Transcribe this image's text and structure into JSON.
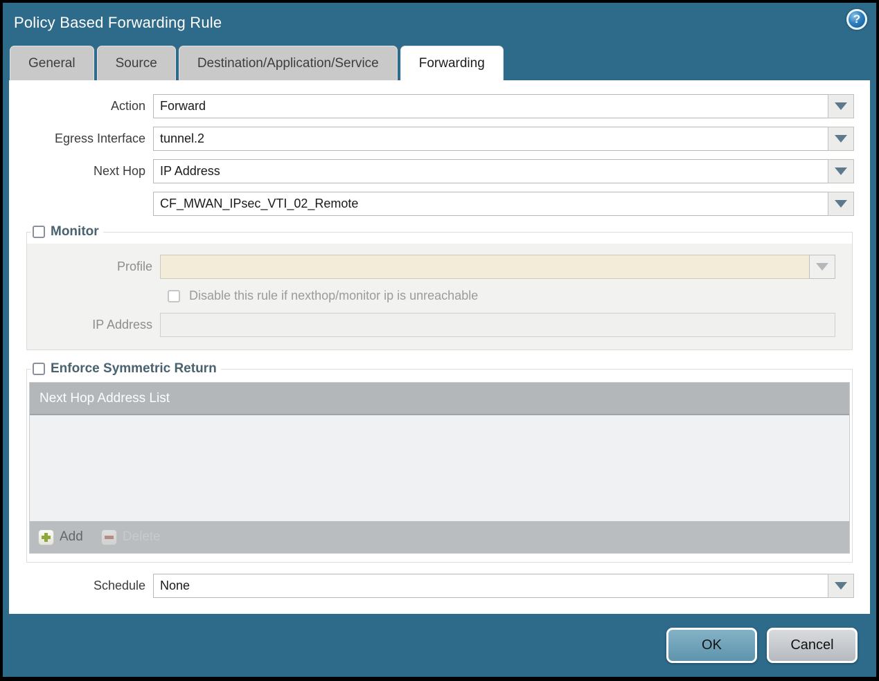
{
  "dialog": {
    "title": "Policy Based Forwarding Rule",
    "help_glyph": "?"
  },
  "tabs": [
    {
      "label": "General",
      "active": false
    },
    {
      "label": "Source",
      "active": false
    },
    {
      "label": "Destination/Application/Service",
      "active": false
    },
    {
      "label": "Forwarding",
      "active": true
    }
  ],
  "form": {
    "action": {
      "label": "Action",
      "value": "Forward"
    },
    "egress": {
      "label": "Egress Interface",
      "value": "tunnel.2"
    },
    "next_hop": {
      "label": "Next Hop",
      "value": "IP Address"
    },
    "next_hop_address": {
      "value": "CF_MWAN_IPsec_VTI_02_Remote"
    },
    "schedule": {
      "label": "Schedule",
      "value": "None"
    }
  },
  "monitor": {
    "legend": "Monitor",
    "checked": false,
    "profile_label": "Profile",
    "profile_value": "",
    "disable_label": "Disable this rule if nexthop/monitor ip is unreachable",
    "disable_checked": false,
    "ip_label": "IP Address",
    "ip_value": ""
  },
  "symmetric_return": {
    "legend": "Enforce Symmetric Return",
    "checked": false,
    "table_header": "Next Hop Address List",
    "rows": [],
    "add_label": "Add",
    "delete_label": "Delete",
    "delete_enabled": false
  },
  "buttons": {
    "ok": "OK",
    "cancel": "Cancel"
  },
  "colors": {
    "frame_teal": "#2e6a8a",
    "tab_inactive": "#c9c9c9",
    "legend_text": "#49626f",
    "profile_input_bg": "#f2ecd9",
    "table_header_bg": "#b3b7ba",
    "ok_button": "#6fa3ba",
    "cancel_button": "#c6c9cd",
    "add_plus_green": "#8fa83b",
    "delete_minus_red": "#b4655c"
  }
}
